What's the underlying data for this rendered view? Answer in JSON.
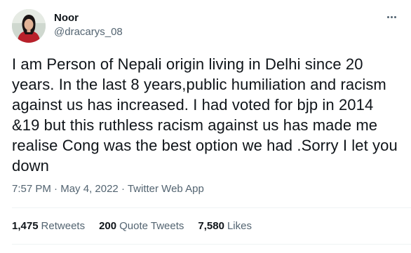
{
  "author": {
    "display_name": "Noor",
    "handle": "@dracarys_08"
  },
  "tweet": {
    "text": "I am Person of Nepali origin living in Delhi since 20 years. In the last 8 years,public humiliation and racism against us has increased. I had voted for bjp in 2014 &19 but this ruthless racism against us has made me realise Cong was the best option we had .Sorry I let you down",
    "time": "7:57 PM",
    "date": "May 4, 2022",
    "source": "Twitter Web App",
    "separator": " · "
  },
  "stats": {
    "retweets_count": "1,475",
    "retweets_label": "Retweets",
    "quotes_count": "200",
    "quotes_label": "Quote Tweets",
    "likes_count": "7,580",
    "likes_label": "Likes"
  },
  "colors": {
    "text_primary": "#0f1419",
    "text_secondary": "#536471",
    "divider": "#eff3f4"
  },
  "icons": {
    "avatar": "user-photo",
    "more": "more-dots-icon"
  }
}
